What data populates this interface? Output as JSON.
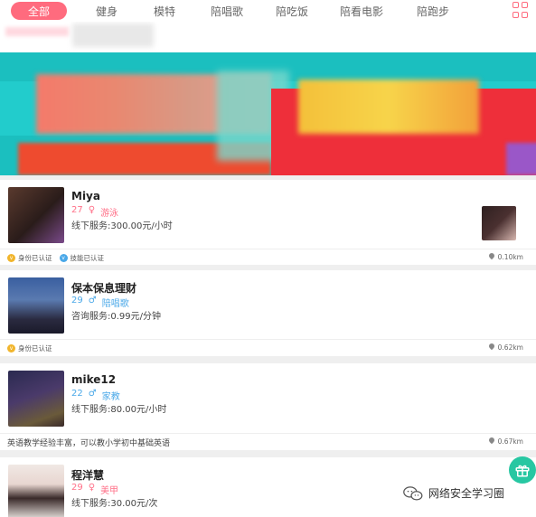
{
  "tabs": [
    {
      "label": "全部",
      "active": true
    },
    {
      "label": "健身"
    },
    {
      "label": "模特"
    },
    {
      "label": "陪唱歌"
    },
    {
      "label": "陪吃饭"
    },
    {
      "label": "陪看电影"
    },
    {
      "label": "陪跑步"
    }
  ],
  "icons": {
    "more": "grid-icon",
    "location": "location-pin-icon",
    "gift": "gift-icon",
    "wechat": "wechat-icon"
  },
  "colors": {
    "accent": "#ff6b7e",
    "female": "#ff7088",
    "male": "#4aa8e8",
    "gift": "#27c7a2"
  },
  "users": [
    {
      "name": "Miya",
      "age": "27",
      "gender": "♀",
      "skill": "游泳",
      "service": "线下服务:300.00元/小时",
      "badges": [
        "身份已认证",
        "技能已认证"
      ],
      "distance": "0.10km"
    },
    {
      "name": "保本保息理财",
      "age": "29",
      "gender": "♂",
      "skill": "陪唱歌",
      "service": "咨询服务:0.99元/分钟",
      "badges": [
        "身份已认证"
      ],
      "distance": "0.62km"
    },
    {
      "name": "mike12",
      "age": "22",
      "gender": "♂",
      "skill": "家教",
      "service": "线下服务:80.00元/小时",
      "intro": "英语教学经验丰富，可以教小学初中基础英语",
      "distance": "0.67km"
    },
    {
      "name": "程洋慧",
      "age": "29",
      "gender": "♀",
      "skill": "美甲",
      "service": "线下服务:30.00元/次"
    }
  ],
  "watermark": "网络安全学习圈"
}
